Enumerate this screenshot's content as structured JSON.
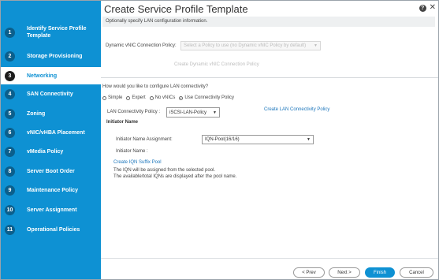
{
  "wizard": {
    "title": "Create Service Profile Template",
    "help_label": "?",
    "close_label": "✕",
    "steps": [
      {
        "num": "1",
        "label": "Identify Service Profile Template"
      },
      {
        "num": "2",
        "label": "Storage Provisioning"
      },
      {
        "num": "3",
        "label": "Networking"
      },
      {
        "num": "4",
        "label": "SAN Connectivity"
      },
      {
        "num": "5",
        "label": "Zoning"
      },
      {
        "num": "6",
        "label": "vNIC/vHBA Placement"
      },
      {
        "num": "7",
        "label": "vMedia Policy"
      },
      {
        "num": "8",
        "label": "Server Boot Order"
      },
      {
        "num": "9",
        "label": "Maintenance Policy"
      },
      {
        "num": "10",
        "label": "Server Assignment"
      },
      {
        "num": "11",
        "label": "Operational Policies"
      }
    ],
    "active_step": "Networking"
  },
  "main": {
    "info": "Optionally specify LAN configuration information.",
    "dynamic_vnic_label": "Dynamic vNIC Connection Policy:",
    "dynamic_vnic_value": "Select a Policy to use (no Dynamic vNIC Policy by default)",
    "create_dynamic_link": "Create Dynamic vNIC Connection Policy",
    "question": "How would you like to configure LAN connectivity?",
    "radio": {
      "simple": "Simple",
      "expert": "Expert",
      "no_vnics": "No vNICs",
      "use_policy": "Use Connectivity Policy"
    },
    "lan_policy_label": "LAN Connectivity Policy :",
    "lan_policy_value": "iSCSI-LAN-Policy",
    "create_lan_link": "Create LAN Connectivity Policy",
    "initiator_name_header": "Initiator Name",
    "initiator_assignment_label": "Initiator Name Assignment:",
    "initiator_assignment_value": "IQN-Pool(16/16)",
    "initiator_name_label": "Initiator Name :",
    "create_iqn_link": "Create IQN Suffix Pool",
    "note1": "The IQN will be assigned from the selected pool.",
    "note2": "The available/total IQNs are displayed after the pool name."
  },
  "footer": {
    "prev": "< Prev",
    "next": "Next >",
    "finish": "Finish",
    "cancel": "Cancel"
  }
}
